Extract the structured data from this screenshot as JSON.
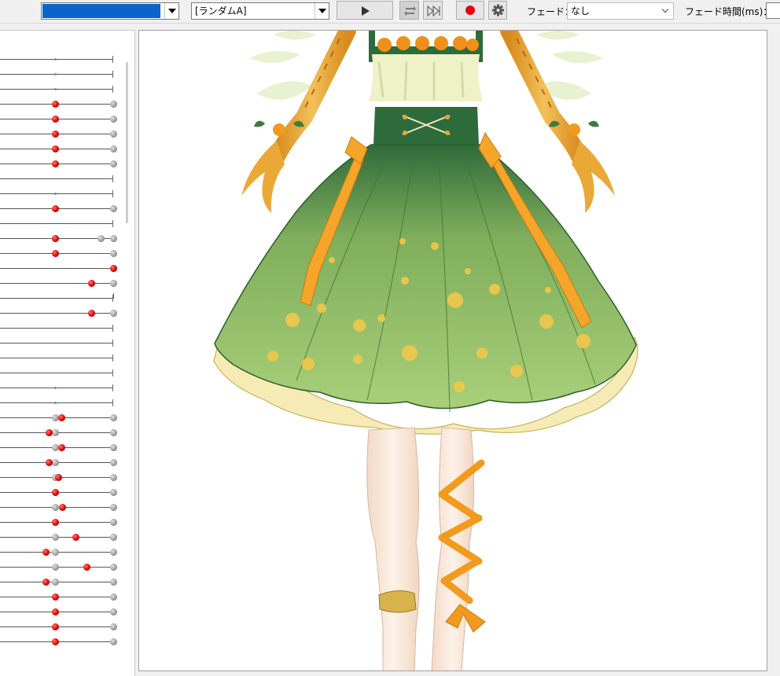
{
  "toolbar": {
    "model_select": {
      "value": ""
    },
    "motion_select": {
      "value": "[ランダムA]"
    },
    "fade_label": "フェード：",
    "fade_select": {
      "value": "なし"
    },
    "fade_time_label": "フェード時間(ms)：",
    "fade_time_value": ""
  },
  "colors": {
    "selection_blue": "#0a64c9",
    "record_red": "#e60012",
    "slider_red": "#e00000"
  },
  "icons": {
    "play": "play-icon",
    "loop": "loop-icon",
    "skip": "skip-forward-icon",
    "record": "record-icon",
    "settings": "gear-icon"
  },
  "parameters": [
    {
      "value": 0.44,
      "kind": "tick"
    },
    {
      "value": 0.44,
      "kind": "tick"
    },
    {
      "value": 0.44,
      "kind": "tick"
    },
    {
      "value": 0.44,
      "kind": "red"
    },
    {
      "value": 0.44,
      "kind": "red"
    },
    {
      "value": 0.44,
      "kind": "red"
    },
    {
      "value": 0.44,
      "kind": "red"
    },
    {
      "value": 0.44,
      "kind": "red"
    },
    {
      "value": 0.44,
      "kind": "none"
    },
    {
      "value": 0.44,
      "kind": "tick"
    },
    {
      "value": 0.44,
      "kind": "red"
    },
    {
      "value": 0.0,
      "kind": "none"
    },
    {
      "value": 0.44,
      "kind": "red",
      "ghost": 0.88
    },
    {
      "value": 0.44,
      "kind": "red"
    },
    {
      "value": 1.0,
      "kind": "red"
    },
    {
      "value": 0.79,
      "kind": "red"
    },
    {
      "value": 1.0,
      "kind": "tickline"
    },
    {
      "value": 0.79,
      "kind": "red"
    },
    {
      "value": 0.0,
      "kind": "none"
    },
    {
      "value": 0.0,
      "kind": "none"
    },
    {
      "value": 0.0,
      "kind": "none"
    },
    {
      "value": 0.0,
      "kind": "none"
    },
    {
      "value": 0.44,
      "kind": "tick"
    },
    {
      "value": 0.44,
      "kind": "tick"
    },
    {
      "value": 0.5,
      "kind": "red",
      "ghost": 0.44
    },
    {
      "value": 0.38,
      "kind": "red",
      "ghost": 0.44
    },
    {
      "value": 0.5,
      "kind": "red",
      "ghost": 0.44
    },
    {
      "value": 0.38,
      "kind": "red",
      "ghost": 0.44
    },
    {
      "value": 0.47,
      "kind": "red",
      "ghost": 0.44
    },
    {
      "value": 0.44,
      "kind": "red",
      "ghost": 0.44
    },
    {
      "value": 0.51,
      "kind": "red",
      "ghost": 0.44
    },
    {
      "value": 0.44,
      "kind": "red"
    },
    {
      "value": 0.64,
      "kind": "red",
      "ghost": 0.44
    },
    {
      "value": 0.35,
      "kind": "red",
      "ghost": 0.44
    },
    {
      "value": 0.74,
      "kind": "red",
      "ghost": 0.44
    },
    {
      "value": 0.35,
      "kind": "red",
      "ghost": 0.44
    },
    {
      "value": 0.44,
      "kind": "red"
    },
    {
      "value": 0.44,
      "kind": "red"
    },
    {
      "value": 0.44,
      "kind": "red"
    },
    {
      "value": 0.44,
      "kind": "red"
    }
  ]
}
